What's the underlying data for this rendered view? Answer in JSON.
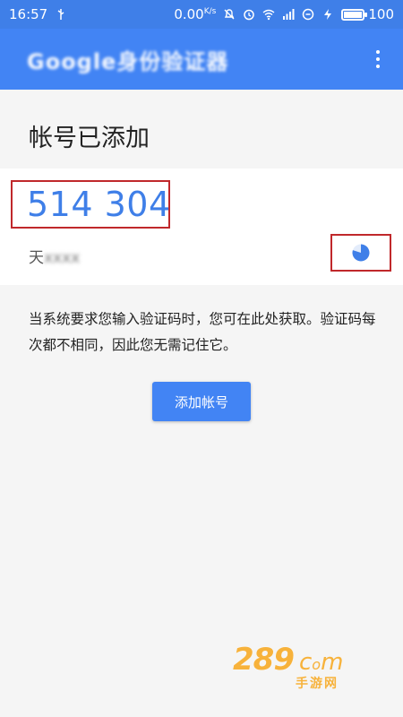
{
  "status_bar": {
    "time": "16:57",
    "speed": "0.00",
    "speed_unit": "K/s",
    "battery": "100",
    "battery_level": 1.0,
    "icons": [
      "usb-icon",
      "mute-icon",
      "alarm-icon",
      "wifi-icon",
      "signal-icon",
      "data-icon",
      "charging-icon",
      "battery-icon"
    ]
  },
  "app_bar": {
    "title": "Google身份验证器",
    "overflow_icon": "more-vert-icon"
  },
  "page": {
    "title": "帐号已添加"
  },
  "account": {
    "code": "514 304",
    "name_visible": "天",
    "name_blurred": "xxxx",
    "timer_icon": "countdown-pie-icon",
    "timer_remaining_fraction": 0.8
  },
  "description": "当系统要求您输入验证码时，您可在此处获取。验证码每次都不相同，因此您无需记住它。",
  "actions": {
    "add_account_label": "添加帐号"
  },
  "watermark": {
    "main": "289",
    "com": "c",
    "com_tail": "m",
    "sub": "手游网"
  },
  "colors": {
    "primary": "#4284f4",
    "status_bar": "#3f7fe8",
    "code": "#3f7fe8",
    "highlight_border": "#c0282b"
  }
}
